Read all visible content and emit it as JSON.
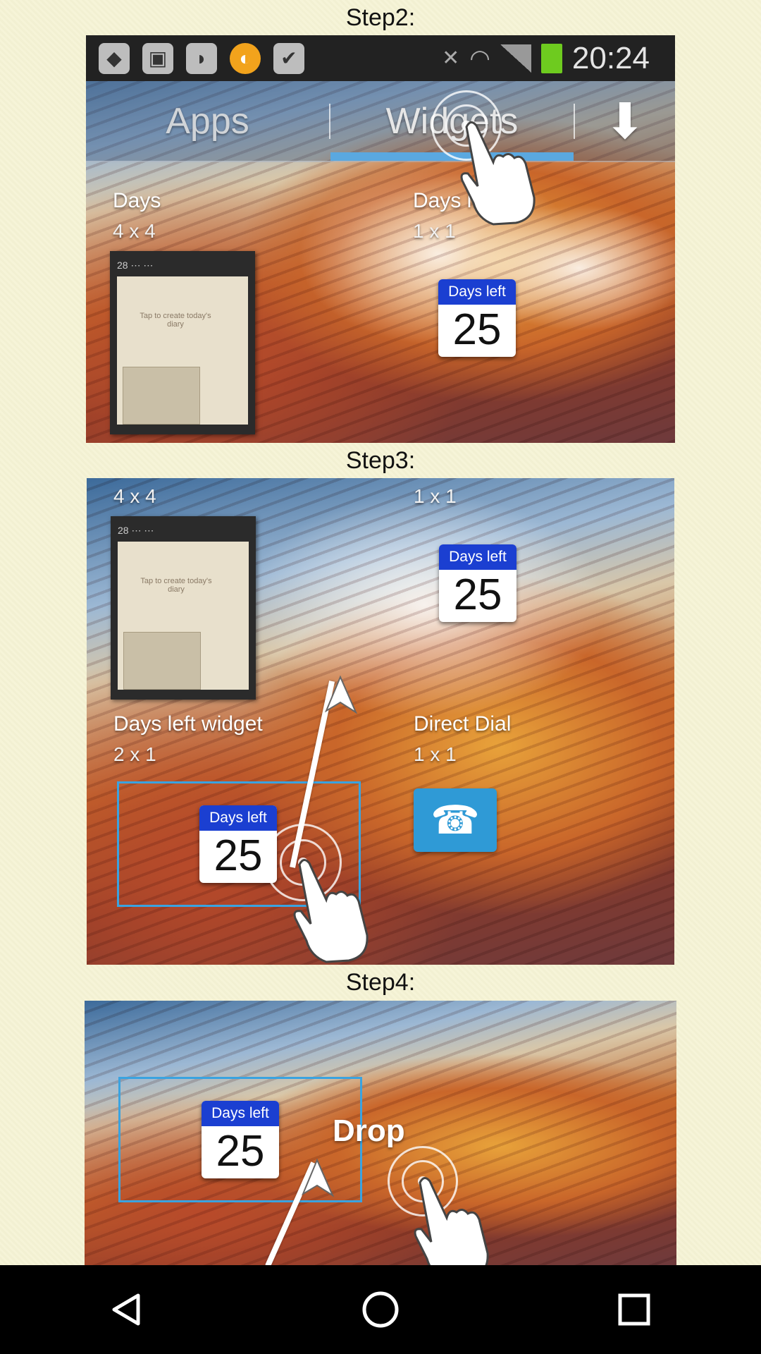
{
  "steps": {
    "step2_label": "Step2:",
    "step3_label": "Step3:",
    "step4_label": "Step4:"
  },
  "status_bar": {
    "time": "20:24",
    "icons": [
      "dropbox-icon",
      "gallery-icon",
      "bag-icon",
      "circle-app-icon",
      "task-icon",
      "mute-icon",
      "wifi-icon",
      "signal-icon",
      "battery-icon"
    ]
  },
  "tabs": {
    "apps": "Apps",
    "widgets": "Widgets",
    "download_icon": "download-icon"
  },
  "widgets": {
    "days": {
      "title": "Days",
      "size": "4 x 4"
    },
    "days_left_1x1": {
      "title": "Days left",
      "size": "1 x 1",
      "badge": "Days left",
      "number": "25"
    },
    "days_left_widget": {
      "title": "Days left widget",
      "size": "2 x 1",
      "badge": "Days left",
      "number": "25"
    },
    "direct_dial": {
      "title": "Direct Dial",
      "size": "1 x 1"
    }
  },
  "diary_text": "Tap to create today's diary",
  "step4": {
    "drop_label": "Drop",
    "badge": "Days left",
    "number": "25"
  },
  "navbar": [
    "back-icon",
    "home-icon",
    "recents-icon"
  ],
  "colors": {
    "accent": "#5aa8e0",
    "badge_blue": "#1b3fd1",
    "battery_green": "#6ecb1f",
    "background": "#f5f3d6"
  }
}
